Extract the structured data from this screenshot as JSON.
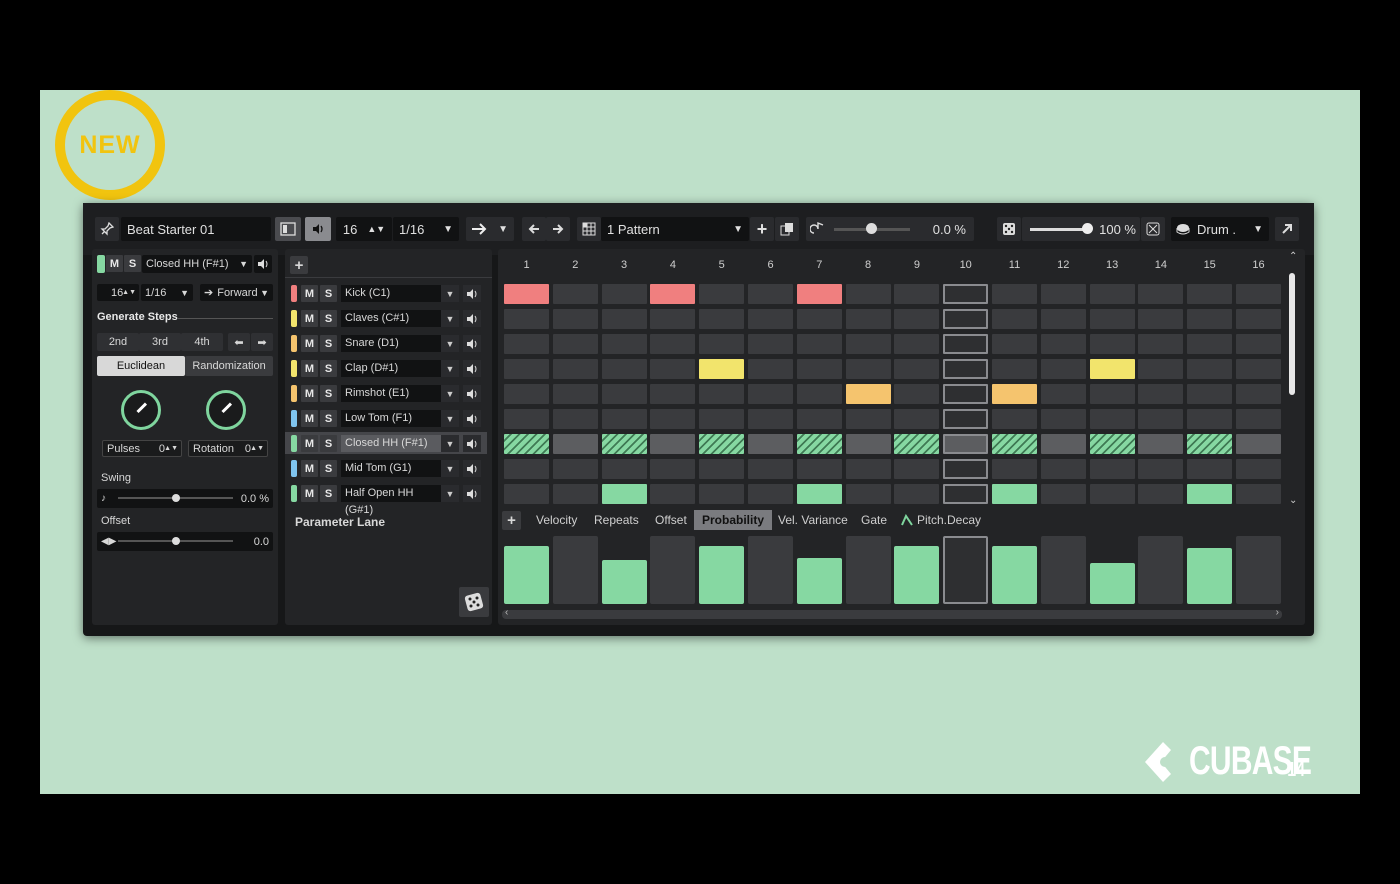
{
  "badge": {
    "text": "NEW",
    "color": "#f1c40f"
  },
  "brand": {
    "name": "CUBASE",
    "version": "14"
  },
  "toolbar": {
    "pattern_name": "Beat Starter 01",
    "steps": "16",
    "resolution": "1/16",
    "pattern": "1 Pattern",
    "swing_value": "0.0 %",
    "random_value": "100 %",
    "drum_map": "Drum ."
  },
  "left": {
    "m": "M",
    "s": "S",
    "lane_name": "Closed HH (F#1)",
    "steps": "16",
    "resolution": "1/16",
    "direction": "Forward",
    "generate_steps": "Generate Steps",
    "gen_buttons": [
      "2nd",
      "3rd",
      "4th"
    ],
    "tab_euclidean": "Euclidean",
    "tab_random": "Randomization",
    "pulses_label": "Pulses",
    "pulses_value": "0",
    "rotation_label": "Rotation",
    "rotation_value": "0",
    "swing_label": "Swing",
    "swing_value": "0.0 %",
    "offset_label": "Offset",
    "offset_value": "0.0"
  },
  "lanes": [
    {
      "name": "Kick (C1)",
      "color": "#f07f7f"
    },
    {
      "name": "Claves (C#1)",
      "color": "#f2e46c"
    },
    {
      "name": "Snare (D1)",
      "color": "#f5c46e"
    },
    {
      "name": "Clap (D#1)",
      "color": "#f2e46c"
    },
    {
      "name": "Rimshot (E1)",
      "color": "#f5c46e"
    },
    {
      "name": "Low Tom (F1)",
      "color": "#7fc4ee"
    },
    {
      "name": "Closed HH (F#1)",
      "color": "#86d8a2",
      "selected": true
    },
    {
      "name": "Mid Tom (G1)",
      "color": "#7fc4ee"
    },
    {
      "name": "Half Open HH (G#1)",
      "color": "#86d8a2"
    }
  ],
  "grid": {
    "columns": [
      "1",
      "2",
      "3",
      "4",
      "5",
      "6",
      "7",
      "8",
      "9",
      "10",
      "11",
      "12",
      "13",
      "14",
      "15",
      "16"
    ],
    "active": [
      [
        1,
        4,
        7
      ],
      [],
      [],
      [
        5,
        13
      ],
      [
        8,
        11
      ],
      [],
      [
        1,
        3,
        5,
        7,
        9,
        11,
        13,
        15
      ],
      [],
      [
        3,
        7,
        11,
        15
      ]
    ],
    "current_step": 10
  },
  "param": {
    "label": "Parameter Lane",
    "tabs": [
      "Velocity",
      "Repeats",
      "Offset",
      "Probability",
      "Vel. Variance",
      "Gate",
      "Pitch.Decay"
    ],
    "active_tab": "Probability",
    "probability": [
      0.85,
      1.0,
      0.65,
      1.0,
      0.85,
      1.0,
      0.67,
      1.0,
      0.85,
      1.0,
      0.85,
      1.0,
      0.6,
      1.0,
      0.82,
      1.0
    ],
    "active_steps": [
      1,
      3,
      5,
      7,
      9,
      11,
      13,
      15
    ]
  }
}
